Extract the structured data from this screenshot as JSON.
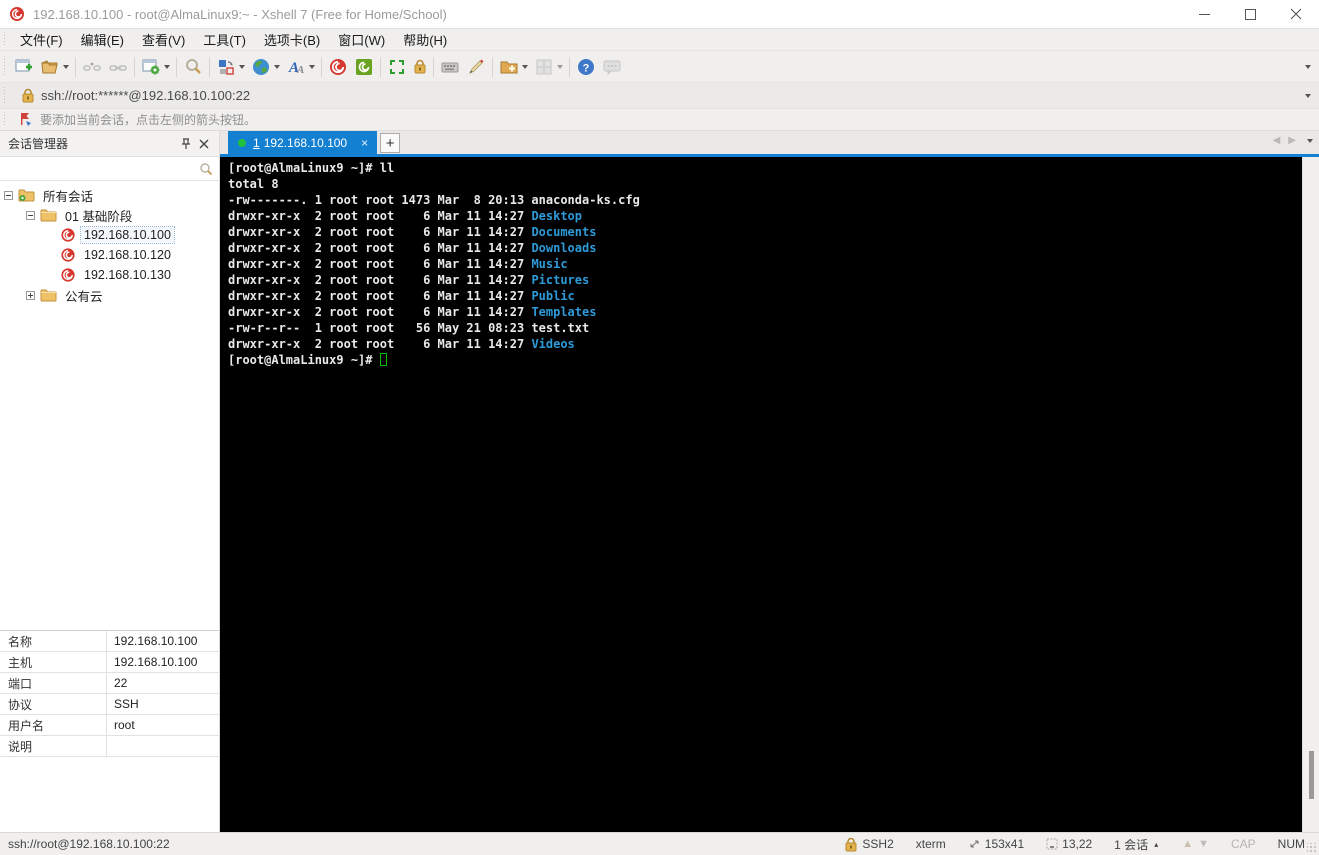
{
  "window": {
    "title": "192.168.10.100 - root@AlmaLinux9:~ - Xshell 7 (Free for Home/School)",
    "app_icon": "xshell-logo-icon",
    "controls": [
      "minimize-icon",
      "maximize-icon",
      "close-icon"
    ]
  },
  "menu_bar": {
    "items": [
      "文件(F)",
      "编辑(E)",
      "查看(V)",
      "工具(T)",
      "选项卡(B)",
      "窗口(W)",
      "帮助(H)"
    ]
  },
  "toolbar": {
    "groups": [
      [
        {
          "icon": "new-session-icon"
        },
        {
          "icon": "open-folder-icon",
          "caret": true
        }
      ],
      [
        {
          "icon": "disconnect-icon",
          "disabled": true
        },
        {
          "icon": "reconnect-icon",
          "disabled": true
        }
      ],
      [
        {
          "icon": "session-properties-icon",
          "caret": true
        }
      ],
      [
        {
          "icon": "find-icon"
        }
      ],
      [
        {
          "icon": "layout-icon",
          "caret": true
        },
        {
          "icon": "globe-icon",
          "caret": true
        },
        {
          "icon": "font-icon",
          "caret": true
        }
      ],
      [
        {
          "icon": "xshell-icon"
        },
        {
          "icon": "xftp-icon"
        }
      ],
      [
        {
          "icon": "fullscreen-icon"
        },
        {
          "icon": "lock-icon"
        }
      ],
      [
        {
          "icon": "keyboard-icon"
        },
        {
          "icon": "highlight-pen-icon"
        }
      ],
      [
        {
          "icon": "new-folder-icon",
          "caret": true
        },
        {
          "icon": "tab-grid-icon",
          "caret": true,
          "disabled": true
        }
      ],
      [
        {
          "icon": "help-icon"
        },
        {
          "icon": "feedback-icon",
          "disabled": true
        }
      ]
    ]
  },
  "address_bar": {
    "icon": "lock-icon",
    "url": "ssh://root:******@192.168.10.100:22"
  },
  "info_bar": {
    "icon": "flag-icon",
    "text": "要添加当前会话，点击左侧的箭头按钮。"
  },
  "session_manager": {
    "title": "会话管理器",
    "search_value": "",
    "tree": [
      {
        "level": 0,
        "expand": "minus",
        "icon": "folder-gear-icon",
        "label": "所有会话"
      },
      {
        "level": 1,
        "expand": "minus",
        "icon": "folder-icon",
        "label": "01 基础阶段"
      },
      {
        "level": 2,
        "icon": "xshell-session-icon",
        "label": "192.168.10.100",
        "focused": true
      },
      {
        "level": 2,
        "icon": "xshell-session-icon",
        "label": "192.168.10.120"
      },
      {
        "level": 2,
        "icon": "xshell-session-icon",
        "label": "192.168.10.130"
      },
      {
        "level": 1,
        "expand": "plus",
        "icon": "folder-icon",
        "label": "公有云"
      }
    ]
  },
  "tab_bar": {
    "active_tab": {
      "number": "1",
      "label": "192.168.10.100"
    },
    "new_tab_label": "+"
  },
  "terminal": {
    "lines": [
      [
        {
          "t": "[root@AlmaLinux9 ~]# ll",
          "c": "p"
        }
      ],
      [
        {
          "t": "total 8",
          "c": "p"
        }
      ],
      [
        {
          "t": "-rw-------. 1 root root 1473 Mar  8 20:13 anaconda-ks.cfg",
          "c": "p"
        }
      ],
      [
        {
          "t": "drwxr-xr-x  2 root root    6 Mar 11 14:27 ",
          "c": "p"
        },
        {
          "t": "Desktop",
          "c": "d"
        }
      ],
      [
        {
          "t": "drwxr-xr-x  2 root root    6 Mar 11 14:27 ",
          "c": "p"
        },
        {
          "t": "Documents",
          "c": "d"
        }
      ],
      [
        {
          "t": "drwxr-xr-x  2 root root    6 Mar 11 14:27 ",
          "c": "p"
        },
        {
          "t": "Downloads",
          "c": "d"
        }
      ],
      [
        {
          "t": "drwxr-xr-x  2 root root    6 Mar 11 14:27 ",
          "c": "p"
        },
        {
          "t": "Music",
          "c": "d"
        }
      ],
      [
        {
          "t": "drwxr-xr-x  2 root root    6 Mar 11 14:27 ",
          "c": "p"
        },
        {
          "t": "Pictures",
          "c": "d"
        }
      ],
      [
        {
          "t": "drwxr-xr-x  2 root root    6 Mar 11 14:27 ",
          "c": "p"
        },
        {
          "t": "Public",
          "c": "d"
        }
      ],
      [
        {
          "t": "drwxr-xr-x  2 root root    6 Mar 11 14:27 ",
          "c": "p"
        },
        {
          "t": "Templates",
          "c": "d"
        }
      ],
      [
        {
          "t": "-rw-r--r--  1 root root   56 May 21 08:23 test.txt",
          "c": "p"
        }
      ],
      [
        {
          "t": "drwxr-xr-x  2 root root    6 Mar 11 14:27 ",
          "c": "p"
        },
        {
          "t": "Videos",
          "c": "d"
        }
      ],
      [
        {
          "t": "[root@AlmaLinux9 ~]# ",
          "c": "p"
        }
      ]
    ],
    "cursor_on_last_line": true
  },
  "properties": {
    "rows": [
      {
        "label": "名称",
        "value": "192.168.10.100"
      },
      {
        "label": "主机",
        "value": "192.168.10.100"
      },
      {
        "label": "端口",
        "value": "22"
      },
      {
        "label": "协议",
        "value": "SSH"
      },
      {
        "label": "用户名",
        "value": "root"
      },
      {
        "label": "说明",
        "value": ""
      }
    ]
  },
  "status_bar": {
    "left": "ssh://root@192.168.10.100:22",
    "items": [
      {
        "icon": "lock-icon",
        "label": "SSH2"
      },
      {
        "label": "xterm"
      },
      {
        "icon": "resize-icon",
        "label": "153x41"
      },
      {
        "icon": "cursor-pos-icon",
        "label": "13,22"
      },
      {
        "label": "1 会话",
        "caret": "▴"
      },
      {
        "icon": "up-arrow-icon"
      },
      {
        "icon": "down-arrow-icon"
      },
      {
        "label": "CAP",
        "disabled": true
      },
      {
        "label": "NUM"
      }
    ]
  },
  "colors": {
    "accent_blue": "#1480d2",
    "terminal_bg": "#000000",
    "terminal_fg": "#e9e9e9",
    "terminal_dir": "#2e9ad8",
    "brand_red": "#d6372e",
    "xftp_green": "#6aa321"
  }
}
